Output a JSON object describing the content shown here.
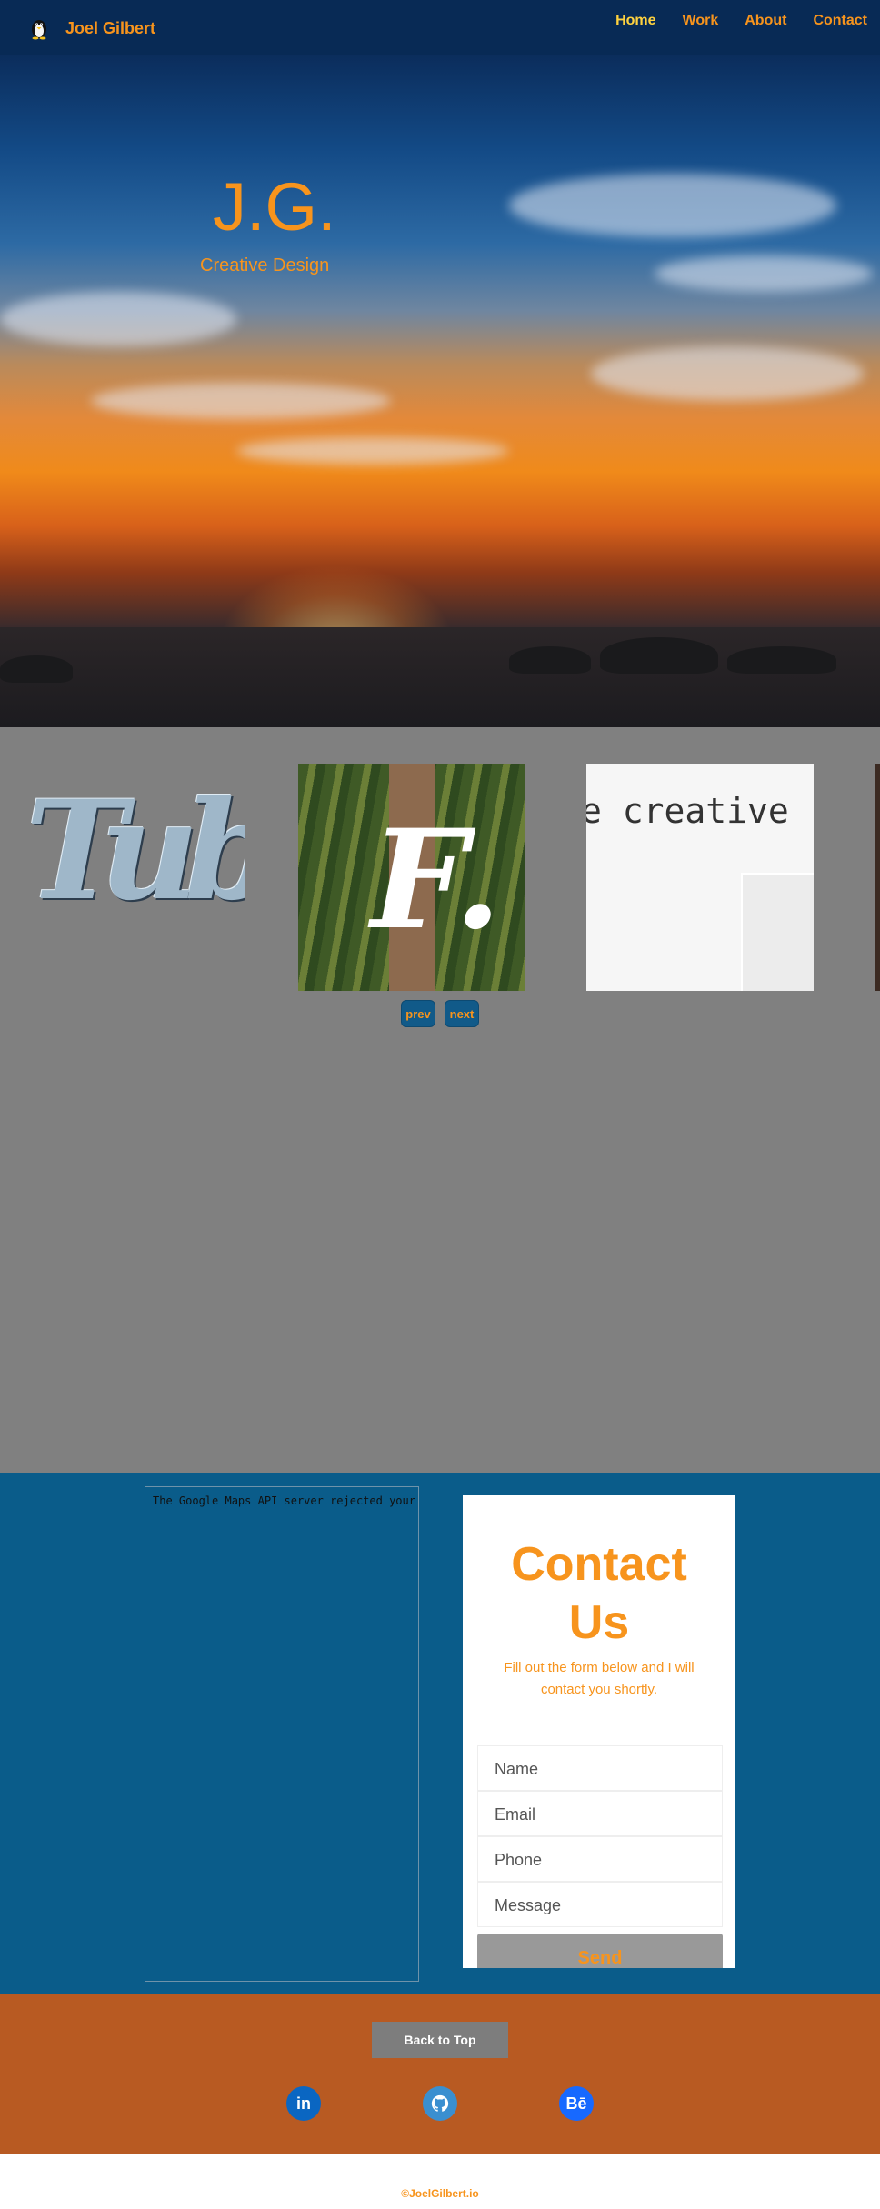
{
  "navbar": {
    "brand_name": "Joel Gilbert",
    "links": [
      {
        "label": "Home"
      },
      {
        "label": "Work"
      },
      {
        "label": "About"
      },
      {
        "label": "Contact"
      }
    ]
  },
  "hero": {
    "title": "J.G.",
    "subtitle": "Creative Design"
  },
  "carousel": {
    "slides": [
      {
        "text": "Tuba"
      },
      {
        "text": "F."
      },
      {
        "text": "e creative"
      }
    ],
    "prev_label": "prev",
    "next_label": "next"
  },
  "map": {
    "message": "The Google Maps API server rejected your request."
  },
  "contact_form": {
    "title_line1": "Contact",
    "title_line2": "Us",
    "description": "Fill out the form below and I will contact you shortly.",
    "fields": {
      "name_placeholder": "Name",
      "email_placeholder": "Email",
      "phone_placeholder": "Phone",
      "message_placeholder": "Message"
    },
    "send_label": "Send"
  },
  "footer": {
    "back_to_top": "Back to Top",
    "social": [
      {
        "label": "in",
        "icon": "linkedin-icon",
        "color": "#0a66c2"
      },
      {
        "label": "",
        "icon": "github-icon",
        "color": "#3a8fd0"
      },
      {
        "label": "Bē",
        "icon": "behance-icon",
        "color": "#1769ff"
      }
    ],
    "copyright": "©JoelGilbert.io"
  },
  "colors": {
    "accent": "#f7941d",
    "active_nav": "#ffd23f",
    "navbar_bg": "#082a55",
    "contact_bg": "#0a5c8a",
    "footer_bg": "#b85a22"
  }
}
